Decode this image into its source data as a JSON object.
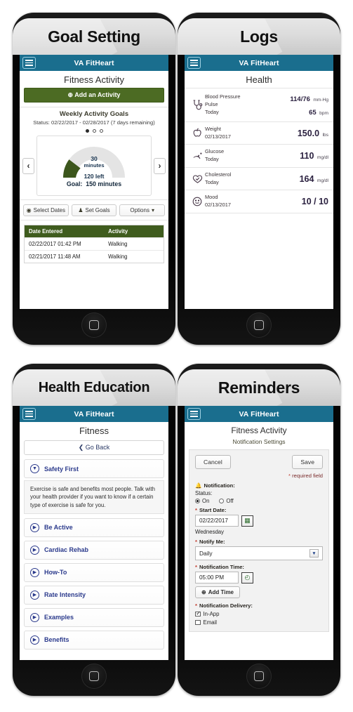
{
  "colors": {
    "navbar": "#1a6e8e",
    "primary_green": "#4c6b23",
    "table_header_green": "#3f5c1e",
    "accordion_blue": "#2b3a8c",
    "required_red": "#c0392b",
    "band_gray": "#dcdcdc"
  },
  "panels": [
    {
      "title": "Goal Setting",
      "app": {
        "brand": "VA FitHeart",
        "menu_icon": "hamburger-icon",
        "page_title": "Fitness Activity",
        "add_activity_label": "Add an Activity",
        "add_icon": "plus-circle-icon",
        "goals_heading": "Weekly Activity Goals",
        "status_text": "Status: 02/22/2017 - 02/28/2017 (7 days remaining)",
        "carousel": {
          "total": 3,
          "active": 1
        },
        "prev_label": "‹",
        "next_label": "›",
        "gauge": {
          "value": 30,
          "value_unit": "minutes",
          "remaining_label": "120 left",
          "goal_label": "Goal:",
          "goal_value": "150 minutes",
          "goal": 150,
          "percent": 20
        },
        "buttons": [
          {
            "label": "Select Dates",
            "icon": "target-icon"
          },
          {
            "label": "Set Goals",
            "icon": "trophy-icon"
          },
          {
            "label": "Options",
            "icon": "caret-down-icon"
          }
        ],
        "table": {
          "headers": [
            "Date Entered",
            "Activity"
          ],
          "rows": [
            [
              "02/22/2017 01:42 PM",
              "Walking"
            ],
            [
              "02/21/2017 11:48 AM",
              "Walking"
            ]
          ]
        }
      }
    },
    {
      "title": "Logs",
      "app": {
        "brand": "VA FitHeart",
        "menu_icon": "hamburger-icon",
        "page_title": "Health",
        "rows": [
          {
            "icon": "stethoscope-icon",
            "name": "Blood Pressure",
            "name2": "Pulse",
            "date": "Today",
            "value": "114/76",
            "unit": "mm-Hg",
            "value2": "65",
            "unit2": "bpm"
          },
          {
            "icon": "apple-icon",
            "name": "Weight",
            "date": "02/13/2017",
            "value": "150.0",
            "unit": "lbs"
          },
          {
            "icon": "glucose-drop-icon",
            "name": "Glucose",
            "date": "Today",
            "value": "110",
            "unit": "mg/dl"
          },
          {
            "icon": "heart-check-icon",
            "name": "Cholesterol",
            "date": "Today",
            "value": "164",
            "unit": "mg/dl"
          },
          {
            "icon": "smiley-icon",
            "name": "Mood",
            "date": "02/13/2017",
            "value": "10 / 10",
            "unit": ""
          }
        ]
      }
    },
    {
      "title": "Health Education",
      "app": {
        "brand": "VA FitHeart",
        "menu_icon": "hamburger-icon",
        "page_title": "Fitness",
        "go_back_label": "Go Back",
        "go_back_icon": "chevron-left-icon",
        "accordions": [
          {
            "label": "Safety First",
            "icon": "caret-down-circle-icon",
            "expanded": true,
            "body": "Exercise is safe and benefits most people. Talk with your health provider if you want to know if a certain type of exercise is safe for you."
          },
          {
            "label": "Be Active",
            "icon": "caret-right-circle-icon",
            "expanded": false
          },
          {
            "label": "Cardiac Rehab",
            "icon": "caret-right-circle-icon",
            "expanded": false
          },
          {
            "label": "How-To",
            "icon": "caret-right-circle-icon",
            "expanded": false
          },
          {
            "label": "Rate Intensity",
            "icon": "caret-right-circle-icon",
            "expanded": false
          },
          {
            "label": "Examples",
            "icon": "caret-right-circle-icon",
            "expanded": false
          },
          {
            "label": "Benefits",
            "icon": "caret-right-circle-icon",
            "expanded": false
          }
        ]
      }
    },
    {
      "title": "Reminders",
      "app": {
        "brand": "VA FitHeart",
        "menu_icon": "hamburger-icon",
        "page_title": "Fitness Activity",
        "page_subtitle": "Notification Settings",
        "cancel_label": "Cancel",
        "save_label": "Save",
        "required_note": "required field",
        "notification_label": "Notification:",
        "notification_icon": "bell-icon",
        "status_label": "Status:",
        "status_on": "On",
        "status_off": "Off",
        "status_value": "On",
        "start_date_label": "Start Date:",
        "start_date_value": "02/22/2017",
        "calendar_icon": "calendar-icon",
        "weekday": "Wednesday",
        "notify_me_label": "Notify Me:",
        "notify_me_value": "Daily",
        "notify_me_options": [
          "Daily"
        ],
        "notification_time_label": "Notification Time:",
        "notification_time_value": "05:00 PM",
        "clock_icon": "clock-icon",
        "add_time_label": "Add Time",
        "add_time_icon": "plus-circle-icon",
        "delivery_label": "Notification Delivery:",
        "delivery": [
          {
            "label": "In-App",
            "checked": true
          },
          {
            "label": "Email",
            "checked": false
          }
        ]
      }
    }
  ]
}
